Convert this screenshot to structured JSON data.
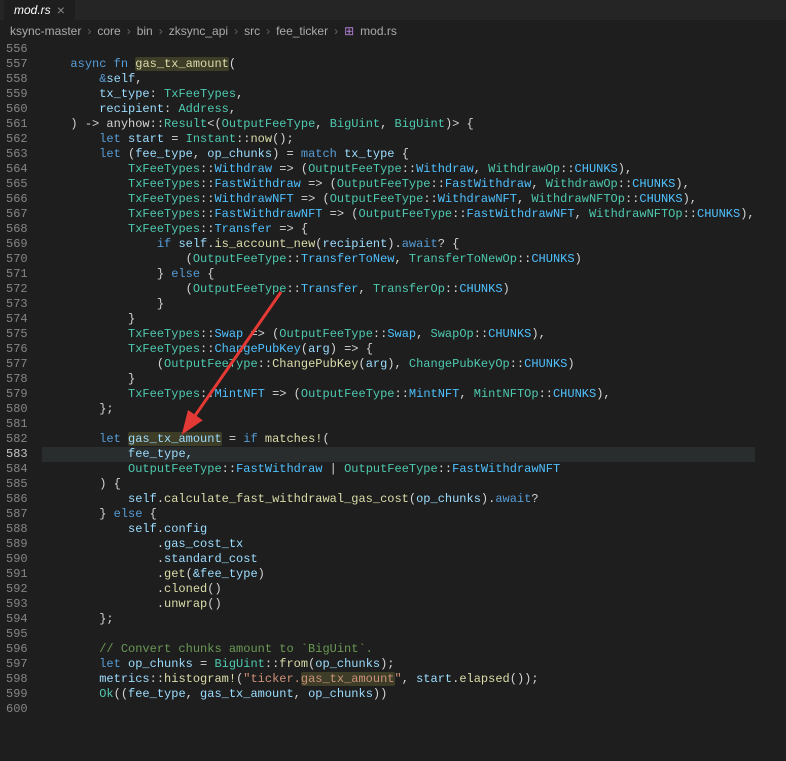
{
  "tab": {
    "filename": "mod.rs"
  },
  "breadcrumb": {
    "items": [
      "ksync-master",
      "core",
      "bin",
      "zksync_api",
      "src",
      "fee_ticker",
      "mod.rs"
    ],
    "symbol": "…"
  },
  "lines": {
    "start": 556,
    "end": 600,
    "current": 583
  },
  "code": {
    "l557": {
      "async": "async",
      "fn": "fn",
      "name": "gas_tx_amount"
    },
    "l558": {
      "self": "&self"
    },
    "l559": {
      "p": "tx_type",
      "t": "TxFeeTypes"
    },
    "l560": {
      "p": "recipient",
      "t": "Address"
    },
    "l561": {
      "ret": ") -> anyhow::",
      "res": "Result",
      "gen": "<(OutputFeeType, BigUint, BigUint)> {"
    },
    "l562": {
      "let": "let",
      "v": "start",
      "eq": " = ",
      "e": "Instant::",
      "fn": "now",
      "end": "();"
    },
    "l563": {
      "let": "let",
      "d": "(fee_type, op_chunks) = ",
      "match": "match",
      "sub": "tx_type {"
    },
    "l564": {
      "a": "TxFeeTypes",
      "b": "::",
      "c": "Withdraw",
      "arr": " => (",
      "d": "OutputFeeType",
      "e": "::",
      "f": "Withdraw",
      "g": ", ",
      "h": "WithdrawOp",
      "i": "::",
      "j": "CHUNKS",
      "k": "),"
    },
    "l565": {
      "a": "TxFeeTypes",
      "c": "FastWithdraw",
      "d": "OutputFeeType",
      "f": "FastWithdraw",
      "h": "WithdrawOp",
      "j": "CHUNKS"
    },
    "l566": {
      "a": "TxFeeTypes",
      "c": "WithdrawNFT",
      "d": "OutputFeeType",
      "f": "WithdrawNFT",
      "h": "WithdrawNFTOp",
      "j": "CHUNKS"
    },
    "l567": {
      "a": "TxFeeTypes",
      "c": "FastWithdrawNFT",
      "d": "OutputFeeType",
      "f": "FastWithdrawNFT",
      "h": "WithdrawNFTOp",
      "j": "CHUNKS"
    },
    "l568": {
      "a": "TxFeeTypes",
      "c": "Transfer",
      "arr": " => {"
    },
    "l569": {
      "iff": "if",
      "self": "self",
      ".": ".",
      "fn": "is_account_new",
      "arg": "recipient",
      "aw": "await",
      "q": "? {"
    },
    "l570": {
      "t": "OutputFeeType",
      "v": "TransferToNew",
      "op": "TransferToNewOp",
      "c": "CHUNKS"
    },
    "l571": {
      "else": "} else {"
    },
    "l572": {
      "t": "OutputFeeType",
      "v": "Transfer",
      "op": "TransferOp",
      "c": "CHUNKS"
    },
    "l573": {
      "b": "}"
    },
    "l574": {
      "b": "}"
    },
    "l575": {
      "a": "TxFeeTypes",
      "c": "Swap",
      "d": "OutputFeeType",
      "f": "Swap",
      "h": "SwapOp",
      "j": "CHUNKS"
    },
    "l576": {
      "a": "TxFeeTypes",
      "c": "ChangePubKey",
      "arg": "arg",
      "arr": " => {"
    },
    "l577": {
      "t": "OutputFeeType",
      "f": "ChangePubKey",
      "arg": "arg",
      "op": "ChangePubKeyOp",
      "c": "CHUNKS"
    },
    "l578": {
      "b": "}"
    },
    "l579": {
      "a": "TxFeeTypes",
      "c": "MintNFT",
      "d": "OutputFeeType",
      "f": "MintNFT",
      "h": "MintNFTOp",
      "j": "CHUNKS"
    },
    "l580": {
      "b": "};"
    },
    "l582": {
      "let": "let",
      "v": "gas_tx_amount",
      "eq": " = ",
      "iff": "if",
      "mac": "matches!",
      "open": "("
    },
    "l583": {
      "v": "fee_type,"
    },
    "l584": {
      "t1": "OutputFeeType",
      "v1": "FastWithdraw",
      "or": " | ",
      "t2": "OutputFeeType",
      "v2": "FastWithdrawNFT"
    },
    "l585": {
      "b": ") {"
    },
    "l586": {
      "self": "self",
      "fn": "calculate_fast_withdrawal_gas_cost",
      "arg": "op_chunks",
      "aw": "await",
      "q": "?"
    },
    "l587": {
      "b": "} else {"
    },
    "l588": {
      "self": "self",
      "f": "config"
    },
    "l589": {
      "f": "gas_cost_tx"
    },
    "l590": {
      "f": "standard_cost"
    },
    "l591": {
      "fn": "get",
      "arg": "&fee_type"
    },
    "l592": {
      "fn": "cloned"
    },
    "l593": {
      "fn": "unwrap"
    },
    "l594": {
      "b": "};"
    },
    "l596": {
      "c": "// Convert chunks amount to `BigUint`."
    },
    "l597": {
      "let": "let",
      "v": "op_chunks",
      "eq": " = ",
      "t": "BigUint",
      "fn": "from",
      "arg": "op_chunks"
    },
    "l598": {
      "m": "metrics",
      "mac": "histogram!",
      "s": "\"ticker.",
      "hl": "gas_tx_amount",
      "s2": "\"",
      "v": "start",
      "fn": "elapsed"
    },
    "l599": {
      "ok": "Ok",
      "a": "fee_type",
      "b": "gas_tx_amount",
      "c": "op_chunks"
    }
  }
}
